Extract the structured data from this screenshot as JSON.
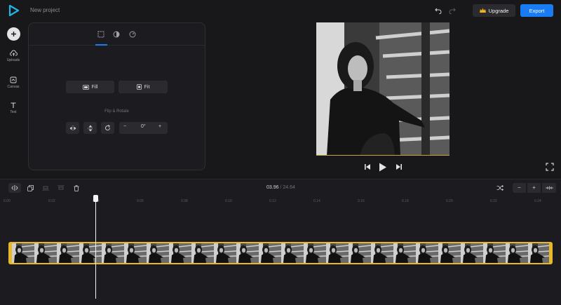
{
  "app": {
    "project_name": "New project"
  },
  "header": {
    "upgrade_label": "Upgrade",
    "export_label": "Export"
  },
  "sidebar": {
    "items": [
      {
        "label": "Uploads",
        "icon": "cloud-upload-icon"
      },
      {
        "label": "Canvas",
        "icon": "canvas-icon"
      },
      {
        "label": "Text",
        "icon": "text-icon"
      }
    ]
  },
  "panel": {
    "tabs": [
      "crop",
      "adjust",
      "speed"
    ],
    "fill_label": "Fill",
    "fit_label": "Fit",
    "flip_rotate_title": "Flip & Rotate",
    "rotation_value": "0°",
    "minus": "−",
    "plus": "+"
  },
  "timeline": {
    "current_time": "03.96",
    "separator": "/",
    "duration": "24.64",
    "ruler": [
      "0.00",
      "0.02",
      "0.04",
      "0.06",
      "0.08",
      "0.10",
      "0.12",
      "0.14",
      "0.16",
      "0.18",
      "0.20",
      "0.22",
      "0.24"
    ],
    "zoom_minus": "−",
    "zoom_plus": "+"
  },
  "colors": {
    "accent": "#1a7cf5",
    "track_border": "#e8b828",
    "background": "#18181b"
  }
}
